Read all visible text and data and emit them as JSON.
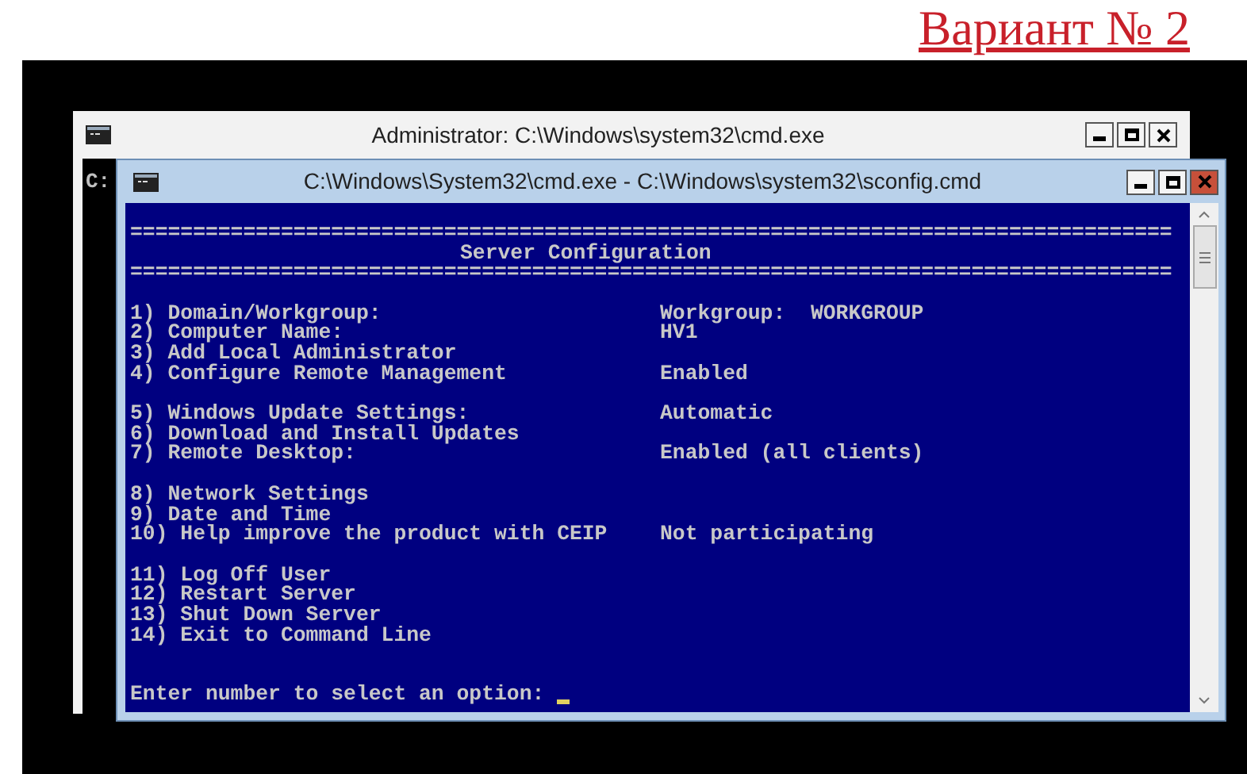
{
  "heading": "Вариант № 2",
  "back_window": {
    "title": "Administrator: C:\\Windows\\system32\\cmd.exe",
    "console_text": "C:"
  },
  "front_window": {
    "title": "C:\\Windows\\System32\\cmd.exe - C:\\Windows\\system32\\sconfig.cmd",
    "separator": "===================================================================================",
    "header": "Server Configuration",
    "separator_bottom": "===================================================================================",
    "menu_groups": [
      [
        {
          "text": "1) Domain/Workgroup:",
          "value": "Workgroup:  WORKGROUP"
        },
        {
          "text": "2) Computer Name:",
          "value": "HV1"
        },
        {
          "text": "3) Add Local Administrator"
        },
        {
          "text": "4) Configure Remote Management",
          "value": "Enabled"
        }
      ],
      [
        {
          "text": "5) Windows Update Settings:",
          "value": "Automatic"
        },
        {
          "text": "6) Download and Install Updates"
        },
        {
          "text": "7) Remote Desktop:",
          "value": "Enabled (all clients)"
        }
      ],
      [
        {
          "text": "8) Network Settings"
        },
        {
          "text": "9) Date and Time"
        },
        {
          "text": "10) Help improve the product with CEIP",
          "value": "Not participating"
        }
      ],
      [
        {
          "text": "11) Log Off User"
        },
        {
          "text": "12) Restart Server"
        },
        {
          "text": "13) Shut Down Server"
        },
        {
          "text": "14) Exit to Command Line"
        }
      ]
    ],
    "prompt": "Enter number to select an option:"
  }
}
